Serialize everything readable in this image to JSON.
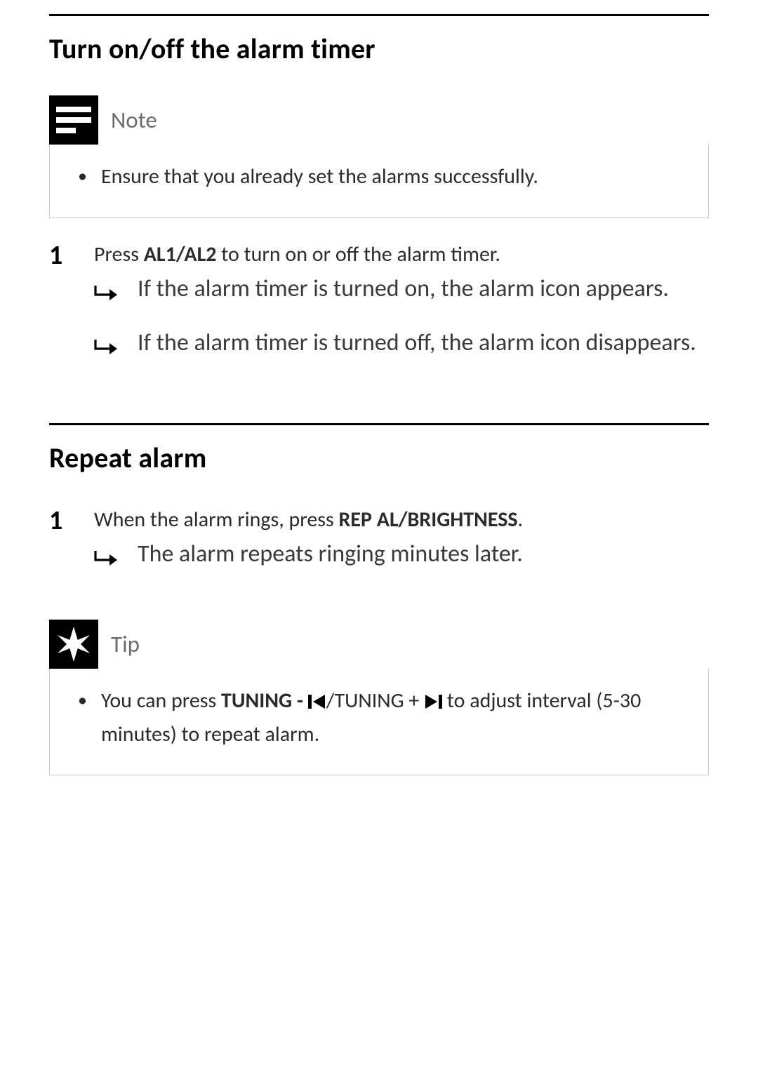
{
  "sections": {
    "alarm": {
      "heading": "Turn on/off the alarm timer",
      "note": {
        "label": "Note",
        "items": [
          "Ensure that you already set the alarms successfully."
        ]
      },
      "step": {
        "num": "1",
        "lead_prefix": "Press ",
        "lead_strong": "AL1/AL2",
        "lead_suffix": " to turn on or off the alarm timer.",
        "results": [
          "If the alarm timer is turned on, the alarm icon appears.",
          "If the alarm timer is turned off, the alarm icon disappears."
        ]
      }
    },
    "repeat": {
      "heading": "Repeat alarm",
      "step": {
        "num": "1",
        "lead_prefix": "When the alarm rings, press ",
        "lead_strong": "REP AL/BRIGHTNESS",
        "lead_suffix": ".",
        "results": [
          "The alarm repeats ringing minutes later."
        ]
      },
      "tip": {
        "label": "Tip",
        "text_prefix": "You can press ",
        "tuning_minus": "TUNING - ",
        "tuning_plus": "TUNING + ",
        "text_suffix": " to adjust interval (5-30 minutes) to repeat alarm."
      }
    }
  }
}
